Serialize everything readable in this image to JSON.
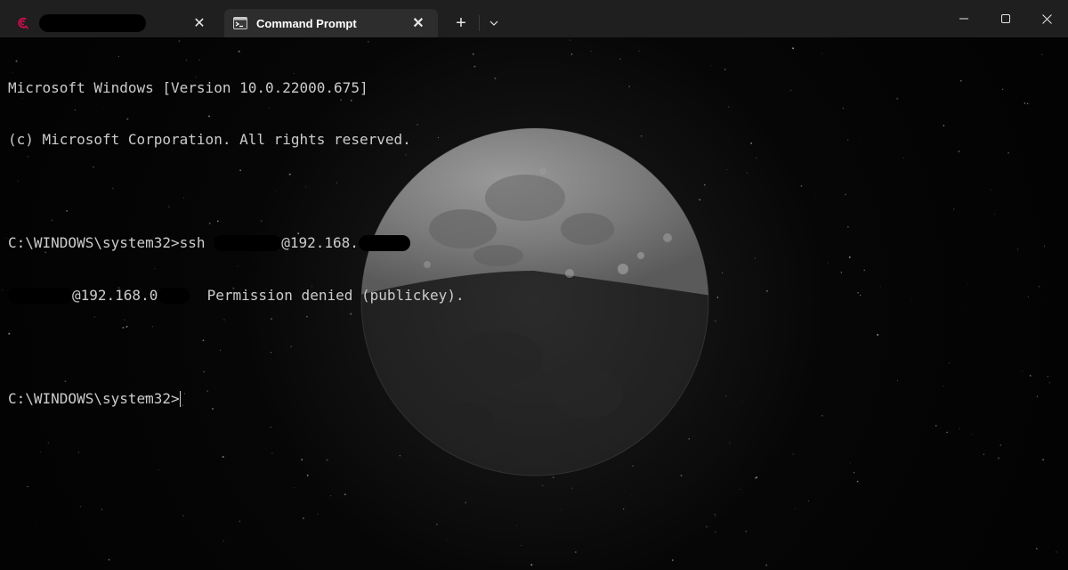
{
  "window": {
    "tabs": [
      {
        "label": "",
        "icon": "debian-icon",
        "active": false,
        "label_redacted": true
      },
      {
        "label": "Command Prompt",
        "icon": "terminal-icon",
        "active": true
      }
    ],
    "new_tab_symbol": "+",
    "close_tab_symbol": "✕"
  },
  "terminal": {
    "header_line1": "Microsoft Windows [Version 10.0.22000.675]",
    "header_line2": "(c) Microsoft Corporation. All rights reserved.",
    "prompt": "C:\\WINDOWS\\system32>",
    "command": "ssh",
    "host_fragment_1": "@192.168.",
    "host_fragment_2": "@192.168.0",
    "error_message": "Permission denied (publickey).",
    "text_color": "#cccccc"
  },
  "colors": {
    "titlebar": "#1f1f1f",
    "active_tab": "#2d2d2d",
    "debian_red": "#d70a53"
  }
}
